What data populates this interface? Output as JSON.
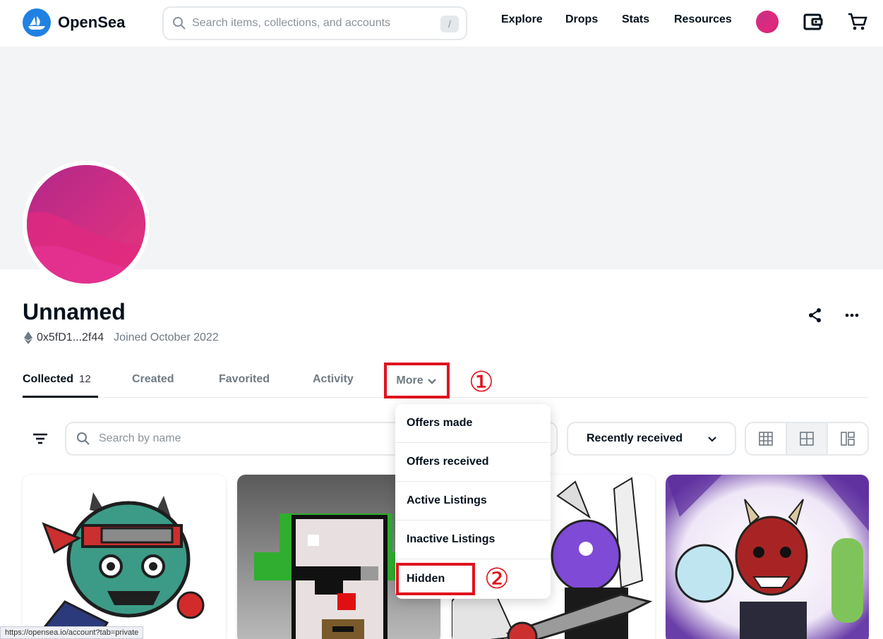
{
  "header": {
    "brand": "OpenSea",
    "search_placeholder": "Search items, collections, and accounts",
    "search_shortcut": "/",
    "nav": [
      "Explore",
      "Drops",
      "Stats",
      "Resources"
    ]
  },
  "profile": {
    "name": "Unnamed",
    "address": "0x5fD1...2f44",
    "joined": "Joined October 2022"
  },
  "tabs": [
    {
      "label": "Collected",
      "count": "12"
    },
    {
      "label": "Created"
    },
    {
      "label": "Favorited"
    },
    {
      "label": "Activity"
    },
    {
      "label": "More"
    }
  ],
  "filters": {
    "search_placeholder": "Search by name",
    "sort_label": "Recently received"
  },
  "dropdown": {
    "items": [
      "Offers made",
      "Offers received",
      "Active Listings",
      "Inactive Listings",
      "Hidden"
    ]
  },
  "annotations": [
    "①",
    "②"
  ],
  "status_bar": {
    "url": "https://opensea.io/account?tab=private"
  },
  "colors": {
    "brand": "#2081e2",
    "annotation": "#e0131e",
    "text": "#04111d"
  }
}
